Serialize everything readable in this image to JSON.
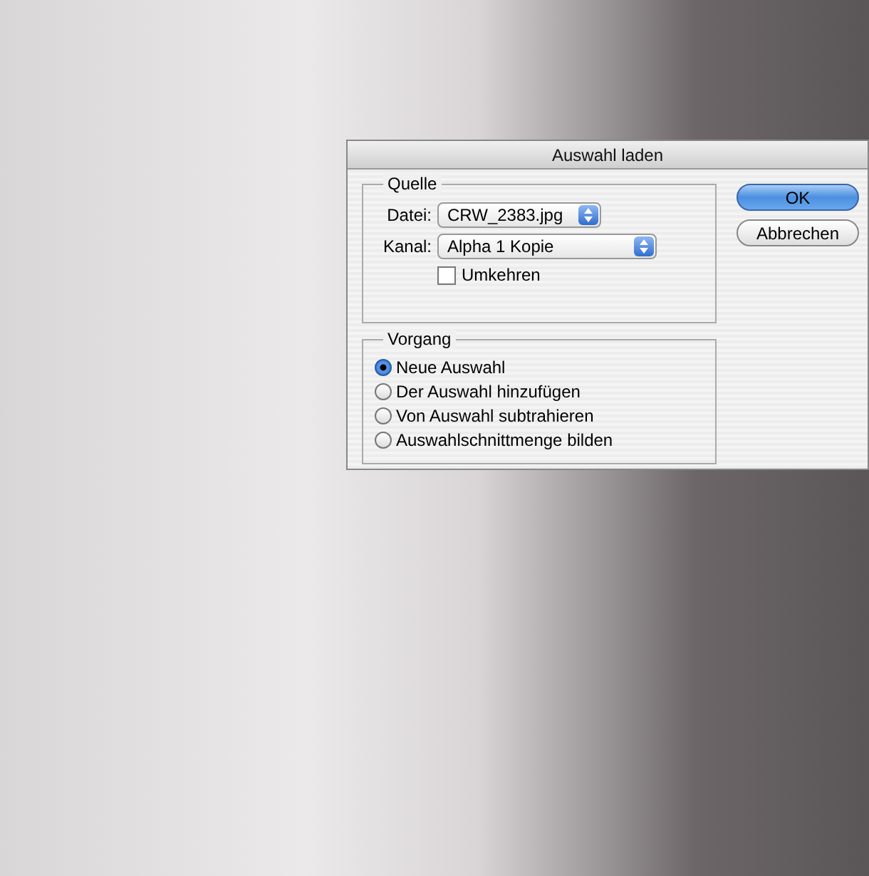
{
  "window": {
    "title": "Auswahl laden"
  },
  "source": {
    "title": "Quelle",
    "file": {
      "label": "Datei:",
      "value": "CRW_2383.jpg"
    },
    "channel": {
      "label": "Kanal:",
      "value": "Alpha 1 Kopie"
    },
    "invert": {
      "label": "Umkehren",
      "checked": false
    }
  },
  "operation": {
    "title": "Vorgang",
    "options": [
      {
        "label": "Neue Auswahl",
        "selected": true
      },
      {
        "label": "Der Auswahl hinzufügen",
        "selected": false
      },
      {
        "label": "Von Auswahl subtrahieren",
        "selected": false
      },
      {
        "label": "Auswahlschnittmenge bilden",
        "selected": false
      }
    ]
  },
  "buttons": [
    {
      "label": "OK",
      "default": true
    },
    {
      "label": "Abbrechen",
      "default": false
    }
  ]
}
